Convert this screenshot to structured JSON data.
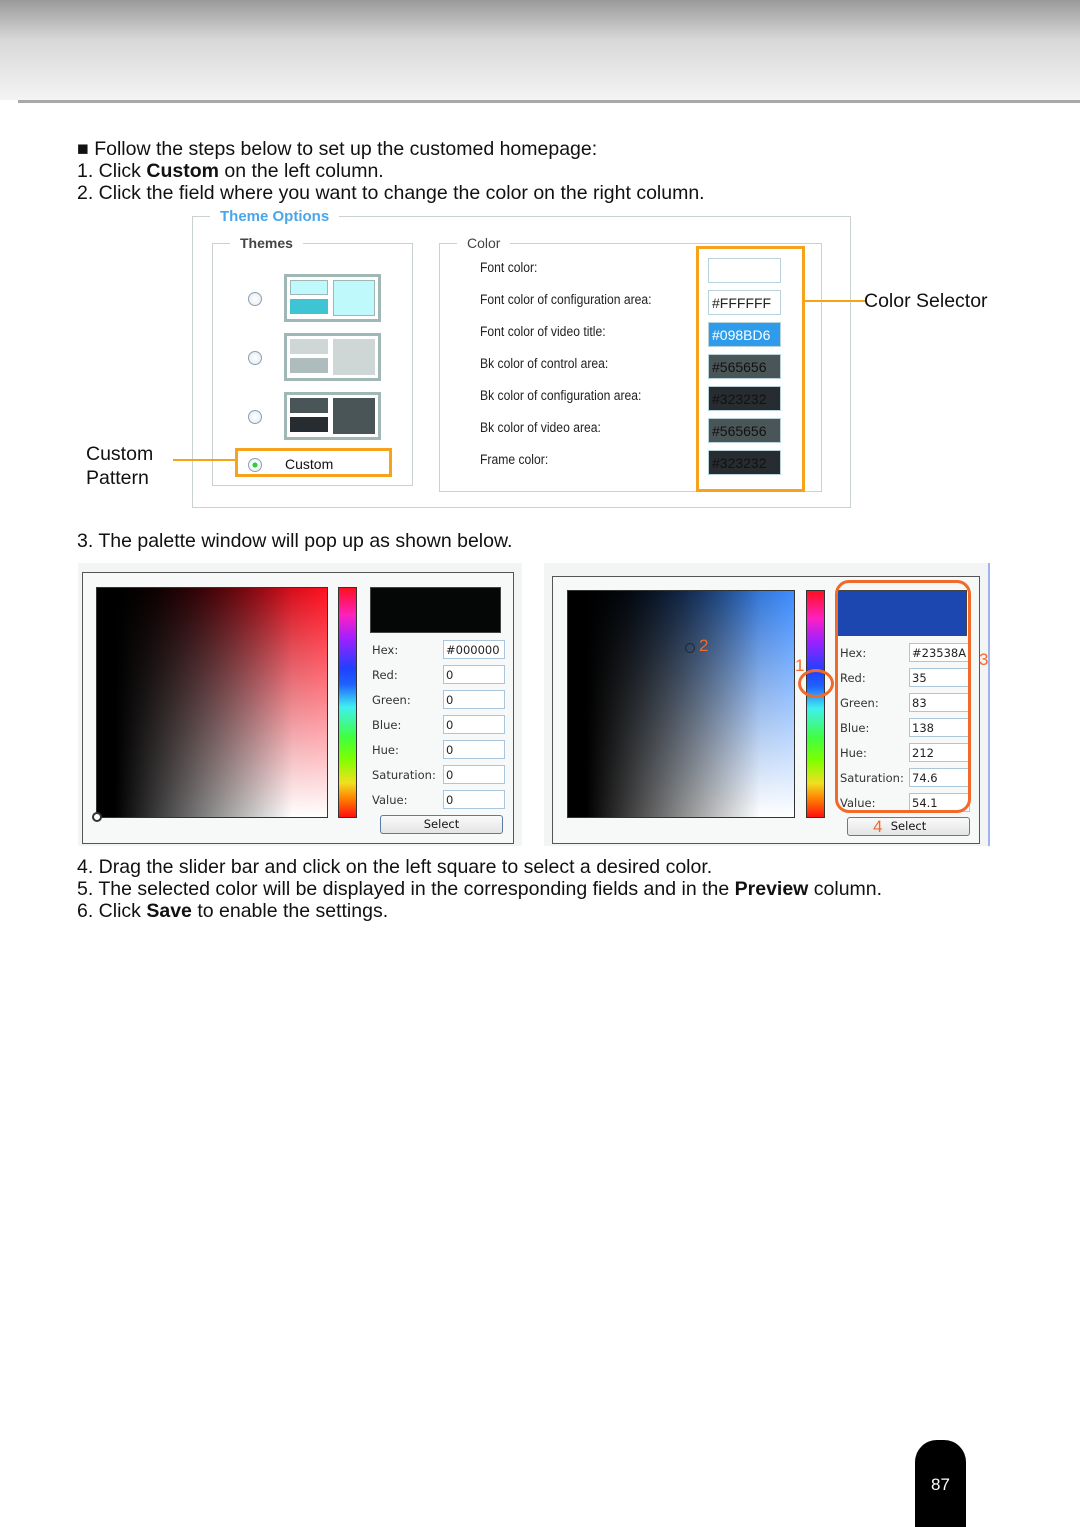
{
  "steps": {
    "intro": "Follow the steps below to set up the customed homepage:",
    "s1_pre": "1. Click ",
    "s1_bold": "Custom",
    "s1_post": " on the left column.",
    "s2": "2. Click the field where you want to change the color on the right column.",
    "s3": "3. The palette window will pop up as shown below.",
    "s4": "4. Drag the slider bar and click on the left square to select a desired color.",
    "s5_pre": "5. The selected color will be displayed in the corresponding fields and in the ",
    "s5_bold": "Preview",
    "s5_post": " column.",
    "s6_pre": "6. Click ",
    "s6_bold": "Save",
    "s6_post": " to enable the settings."
  },
  "theme_options": {
    "title": "Theme Options",
    "themes_legend": "Themes",
    "custom_label": "Custom",
    "color_legend": "Color",
    "rows": [
      {
        "label": "Font color:",
        "value": "",
        "color": "#FFFFFF"
      },
      {
        "label": "Font color of configuration area:",
        "value": "#FFFFFF",
        "color": "#FFFFFF"
      },
      {
        "label": "Font color of video title:",
        "value": "#098BD6",
        "color": "#2E9CEB"
      },
      {
        "label": "Bk color of control area:",
        "value": "#565656",
        "color": "#4A5558"
      },
      {
        "label": "Bk color of configuration area:",
        "value": "#323232",
        "color": "#262C30"
      },
      {
        "label": "Bk color of video area:",
        "value": "#565656",
        "color": "#4A5558"
      },
      {
        "label": "Frame color:",
        "value": "#323232",
        "color": "#262C30"
      }
    ]
  },
  "callouts": {
    "custom_pattern_1": "Custom",
    "custom_pattern_2": "Pattern",
    "color_selector": "Color Selector"
  },
  "palette_default": {
    "fields": [
      {
        "label": "Hex:",
        "value": "#000000"
      },
      {
        "label": "Red:",
        "value": "0"
      },
      {
        "label": "Green:",
        "value": "0"
      },
      {
        "label": "Blue:",
        "value": "0"
      },
      {
        "label": "Hue:",
        "value": "0"
      },
      {
        "label": "Saturation:",
        "value": "0"
      },
      {
        "label": "Value:",
        "value": "0"
      }
    ],
    "select_label": "Select",
    "preview_color": "#050707"
  },
  "palette_selected": {
    "fields": [
      {
        "label": "Hex:",
        "value": "#23538A"
      },
      {
        "label": "Red:",
        "value": "35"
      },
      {
        "label": "Green:",
        "value": "83"
      },
      {
        "label": "Blue:",
        "value": "138"
      },
      {
        "label": "Hue:",
        "value": "212"
      },
      {
        "label": "Saturation:",
        "value": "74.6"
      },
      {
        "label": "Value:",
        "value": "54.1"
      }
    ],
    "select_label": "Select",
    "preview_color": "#1C46B0",
    "markers": [
      "1",
      "2",
      "3",
      "4"
    ]
  },
  "page_number": "87",
  "accent_color": "#F7A21B"
}
